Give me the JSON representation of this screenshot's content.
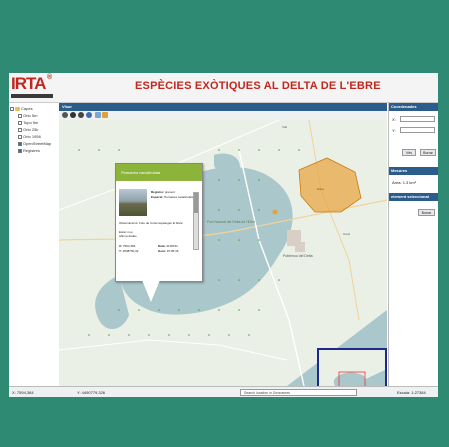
{
  "header": {
    "logo_text": "IRTA",
    "logo_sup": "®",
    "title": "ESPÈCIES EXÒTIQUES AL DELTA DE L'EBRE"
  },
  "layers": {
    "root_label": "Capes",
    "items": [
      {
        "label": "Orto 5m",
        "checked": false
      },
      {
        "label": "Topo 5m",
        "checked": false
      },
      {
        "label": "Orto 25k",
        "checked": false
      },
      {
        "label": "Orto 1956",
        "checked": false
      },
      {
        "label": "OpenStreetMap",
        "checked": true
      },
      {
        "label": "Registres",
        "checked": true
      }
    ]
  },
  "visor": {
    "title": "Visor"
  },
  "popup": {
    "species_title": "Pomacea canaliculata",
    "registre_label": "Registre:",
    "registre_value": "present",
    "especie_label": "Espècie:",
    "especie_value": "Pomacea canaliculata",
    "observacions": "Observacions: Foto de l'entomopatogen E blanc",
    "estat_label": "Estat: nou",
    "afirmacio": "Afirma dades",
    "x_label": "X:",
    "x_value": "7594,384",
    "y_label": "Y:",
    "y_value": "4508750,32",
    "date_label": "Data:",
    "date_value": "21/08/11",
    "hour_label": "Hora:",
    "hour_value": "15:05:46"
  },
  "map_labels": {
    "lake": "Port Natural del Delta de l'Ebre",
    "area_town": "Poblenou del Delta",
    "road1": "Vial",
    "road2": "Camí",
    "highlight": "Zona"
  },
  "right_panel": {
    "coord_title": "Coordenades",
    "x_label": "X:",
    "y_label": "Y:",
    "go_button": "Vés",
    "clear_button": "Borrar",
    "measures_title": "Mesures",
    "area_label": "Àrea:",
    "area_value": "1.3 km²",
    "selected_title": "element seleccionat",
    "delete_button": "Borrar"
  },
  "status": {
    "x_text": "X: 7594,384",
    "y_text": "Y: 4490779,326",
    "search_placeholder": "Search location in Geonames",
    "scale_text": "Escala: 1:27384"
  },
  "colors": {
    "brand_red": "#c0281f",
    "panel_blue": "#2b5c8a",
    "highlight_orange": "#e8a23a",
    "water": "#aac7cc",
    "land": "#eaf0e6",
    "background": "#2e8a72"
  }
}
